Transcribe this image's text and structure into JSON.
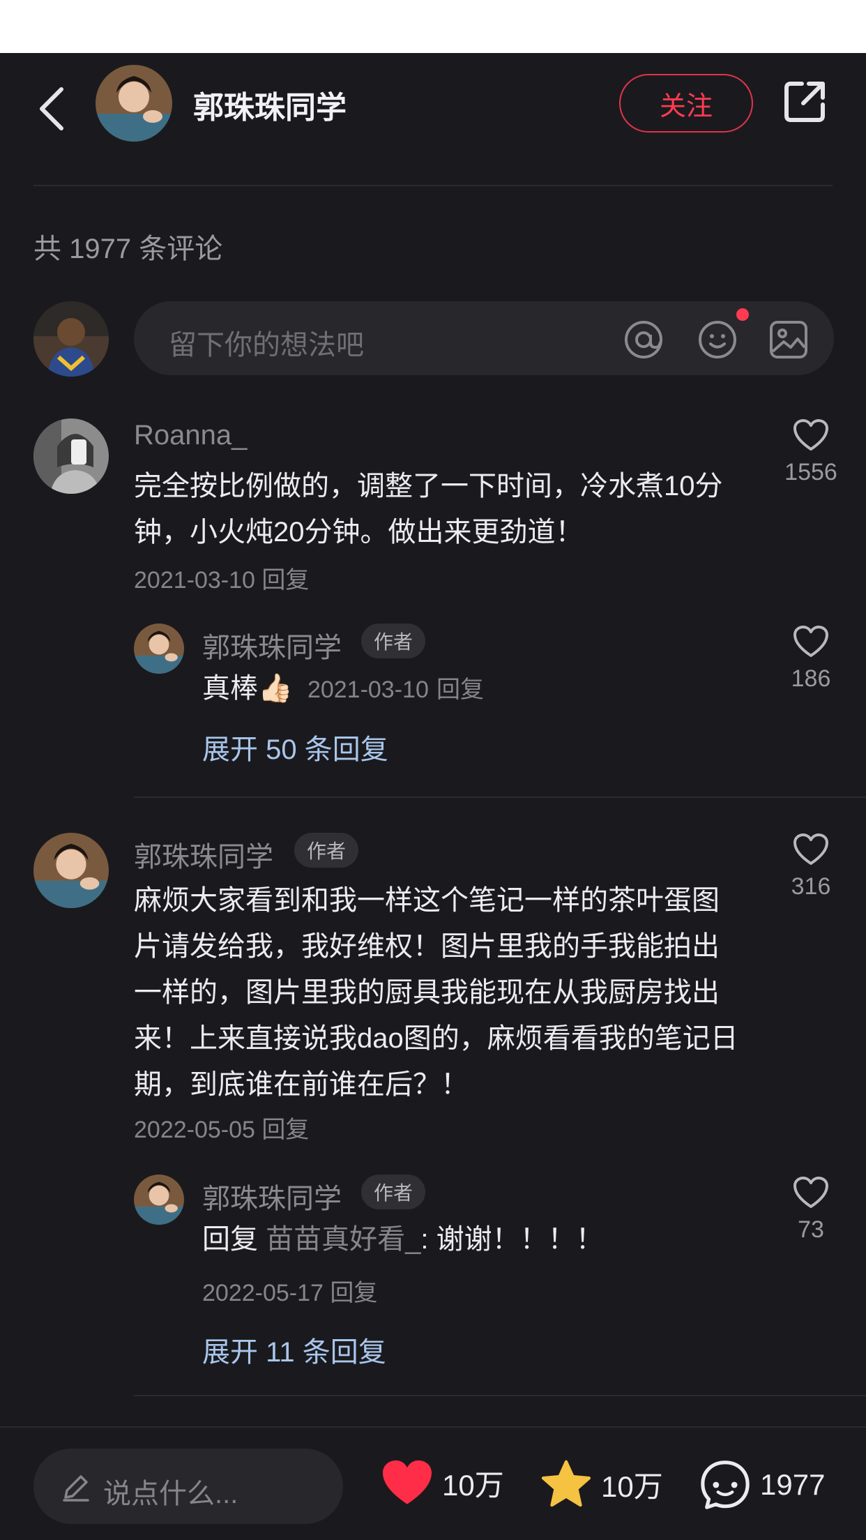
{
  "header": {
    "author_name": "郭珠珠同学",
    "follow_label": "关注"
  },
  "comments_summary": {
    "text": "共 1977 条评论"
  },
  "input": {
    "placeholder": "留下你的想法吧"
  },
  "comments": [
    {
      "name": "Roanna_",
      "text": "完全按比例做的，调整了一下时间，冷水煮10分钟，小火炖20分钟。做出来更劲道！",
      "date": "2021-03-10",
      "reply_label": "回复",
      "likes": "1556",
      "reply": {
        "name": "郭珠珠同学",
        "badge": "作者",
        "text": "真棒👍🏻",
        "date": "2021-03-10",
        "reply_label": "回复",
        "likes": "186"
      },
      "expand": "展开 50 条回复"
    },
    {
      "name": "郭珠珠同学",
      "badge": "作者",
      "text": "麻烦大家看到和我一样这个笔记一样的茶叶蛋图片请发给我，我好维权！图片里我的手我能拍出一样的，图片里我的厨具我能现在从我厨房找出来！上来直接说我dao图的，麻烦看看我的笔记日期，到底谁在前谁在后？！",
      "date": "2022-05-05",
      "reply_label": "回复",
      "likes": "316",
      "reply": {
        "name": "郭珠珠同学",
        "badge": "作者",
        "prefix": "回复",
        "mention": "苗苗真好看_",
        "text": ": 谢谢！！！！",
        "date": "2022-05-17",
        "reply_label": "回复",
        "likes": "73"
      },
      "expand": "展开 11 条回复"
    }
  ],
  "bottom_bar": {
    "say_placeholder": "说点什么...",
    "likes": "10万",
    "stars": "10万",
    "comments": "1977"
  },
  "colors": {
    "background": "#1a1a1e",
    "accent_red": "#ff3b52",
    "star_yellow": "#f5c242",
    "link_blue": "#a9c6ec"
  }
}
